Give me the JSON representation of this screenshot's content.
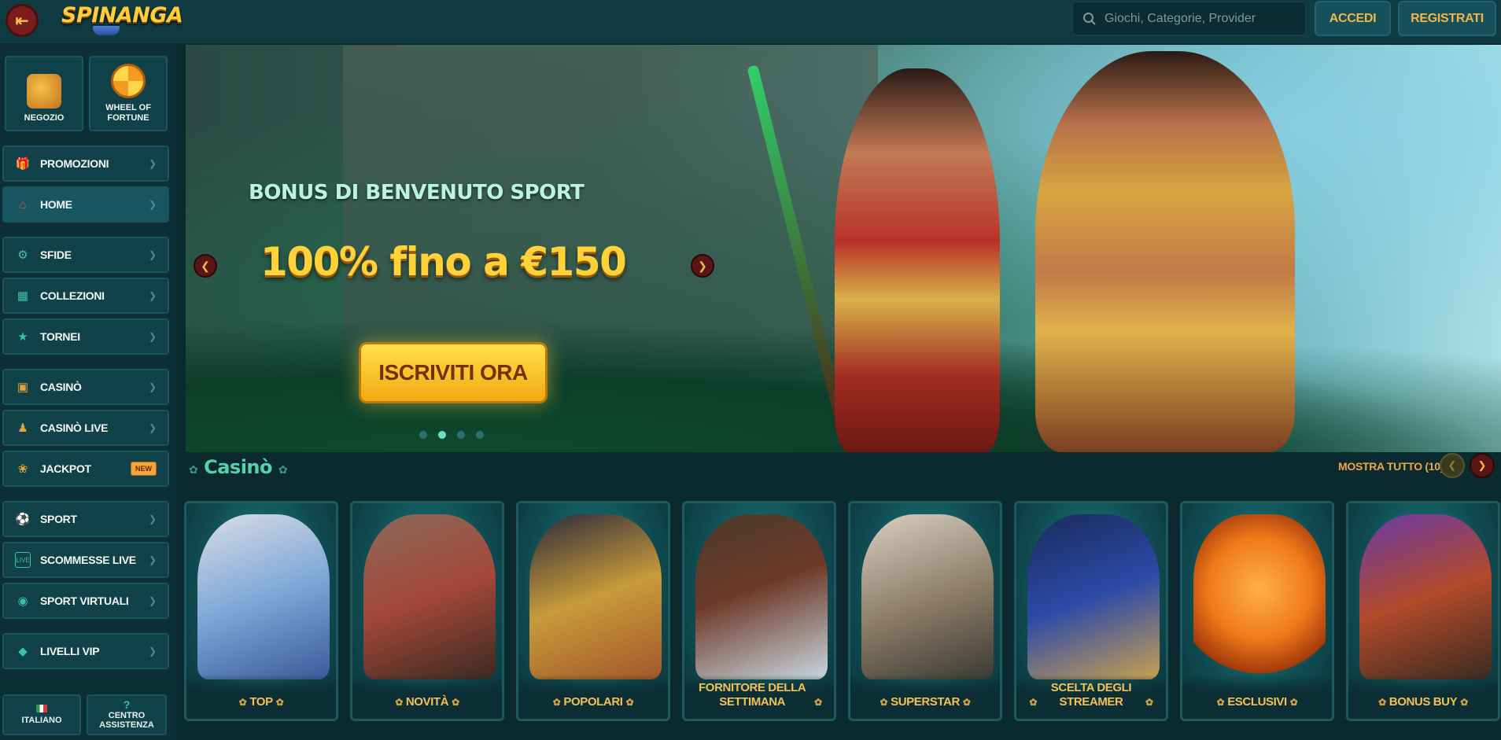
{
  "header": {
    "menu_icon": "menu-back-icon",
    "logo_text": "SPINANGA",
    "search_placeholder": "Giochi, Categorie, Provider",
    "login_label": "ACCEDI",
    "register_label": "REGISTRATI"
  },
  "sidebar": {
    "tiles": [
      {
        "label": "NEGOZIO",
        "icon": "shop-basket-icon"
      },
      {
        "label": "WHEEL OF FORTUNE",
        "icon": "wheel-of-fortune-icon"
      }
    ],
    "items": [
      {
        "label": "PROMOZIONI",
        "icon": "gift-icon"
      },
      {
        "label": "HOME",
        "icon": "home-icon"
      },
      {
        "label": "SFIDE",
        "icon": "challenge-icon"
      },
      {
        "label": "COLLEZIONI",
        "icon": "cards-icon"
      },
      {
        "label": "TORNEI",
        "icon": "trophy-icon"
      },
      {
        "label": "CASINÒ",
        "icon": "chest-icon"
      },
      {
        "label": "CASINÒ LIVE",
        "icon": "dealer-icon"
      },
      {
        "label": "JACKPOT",
        "icon": "coins-icon",
        "badge": "NEW"
      },
      {
        "label": "SPORT",
        "icon": "soccer-ball-icon"
      },
      {
        "label": "SCOMMESSE LIVE",
        "icon": "live-icon"
      },
      {
        "label": "SPORT VIRTUALI",
        "icon": "virtual-sport-icon"
      },
      {
        "label": "LIVELLI VIP",
        "icon": "diamond-icon"
      }
    ],
    "language": "ITALIANO",
    "support": "CENTRO ASSISTENZA"
  },
  "hero": {
    "subtitle": "BONUS DI BENVENUTO SPORT",
    "title": "100% fino a €150",
    "cta": "ISCRIVITI ORA",
    "active_slide": 2,
    "slide_count": 4
  },
  "casino": {
    "title": "Casinò",
    "show_all": "MOSTRA TUTTO (10)",
    "categories": [
      {
        "label": "TOP",
        "accent": "#7fa8d8"
      },
      {
        "label": "NOVITÀ",
        "accent": "#a4473a"
      },
      {
        "label": "POPOLARI",
        "accent": "#c89a3a"
      },
      {
        "label": "FORNITORE DELLA SETTIMANA",
        "accent": "#6e3a2a"
      },
      {
        "label": "SUPERSTAR",
        "accent": "#8a7a64"
      },
      {
        "label": "SCELTA DEGLI STREAMER",
        "accent": "#2d4aa8"
      },
      {
        "label": "ESCLUSIVI",
        "accent": "#f07a1a"
      },
      {
        "label": "BONUS BUY",
        "accent": "#b24a2a"
      }
    ]
  },
  "colors": {
    "background": "#0b2a30",
    "accent_gold": "#f0a548",
    "accent_teal": "#55d2a8"
  }
}
